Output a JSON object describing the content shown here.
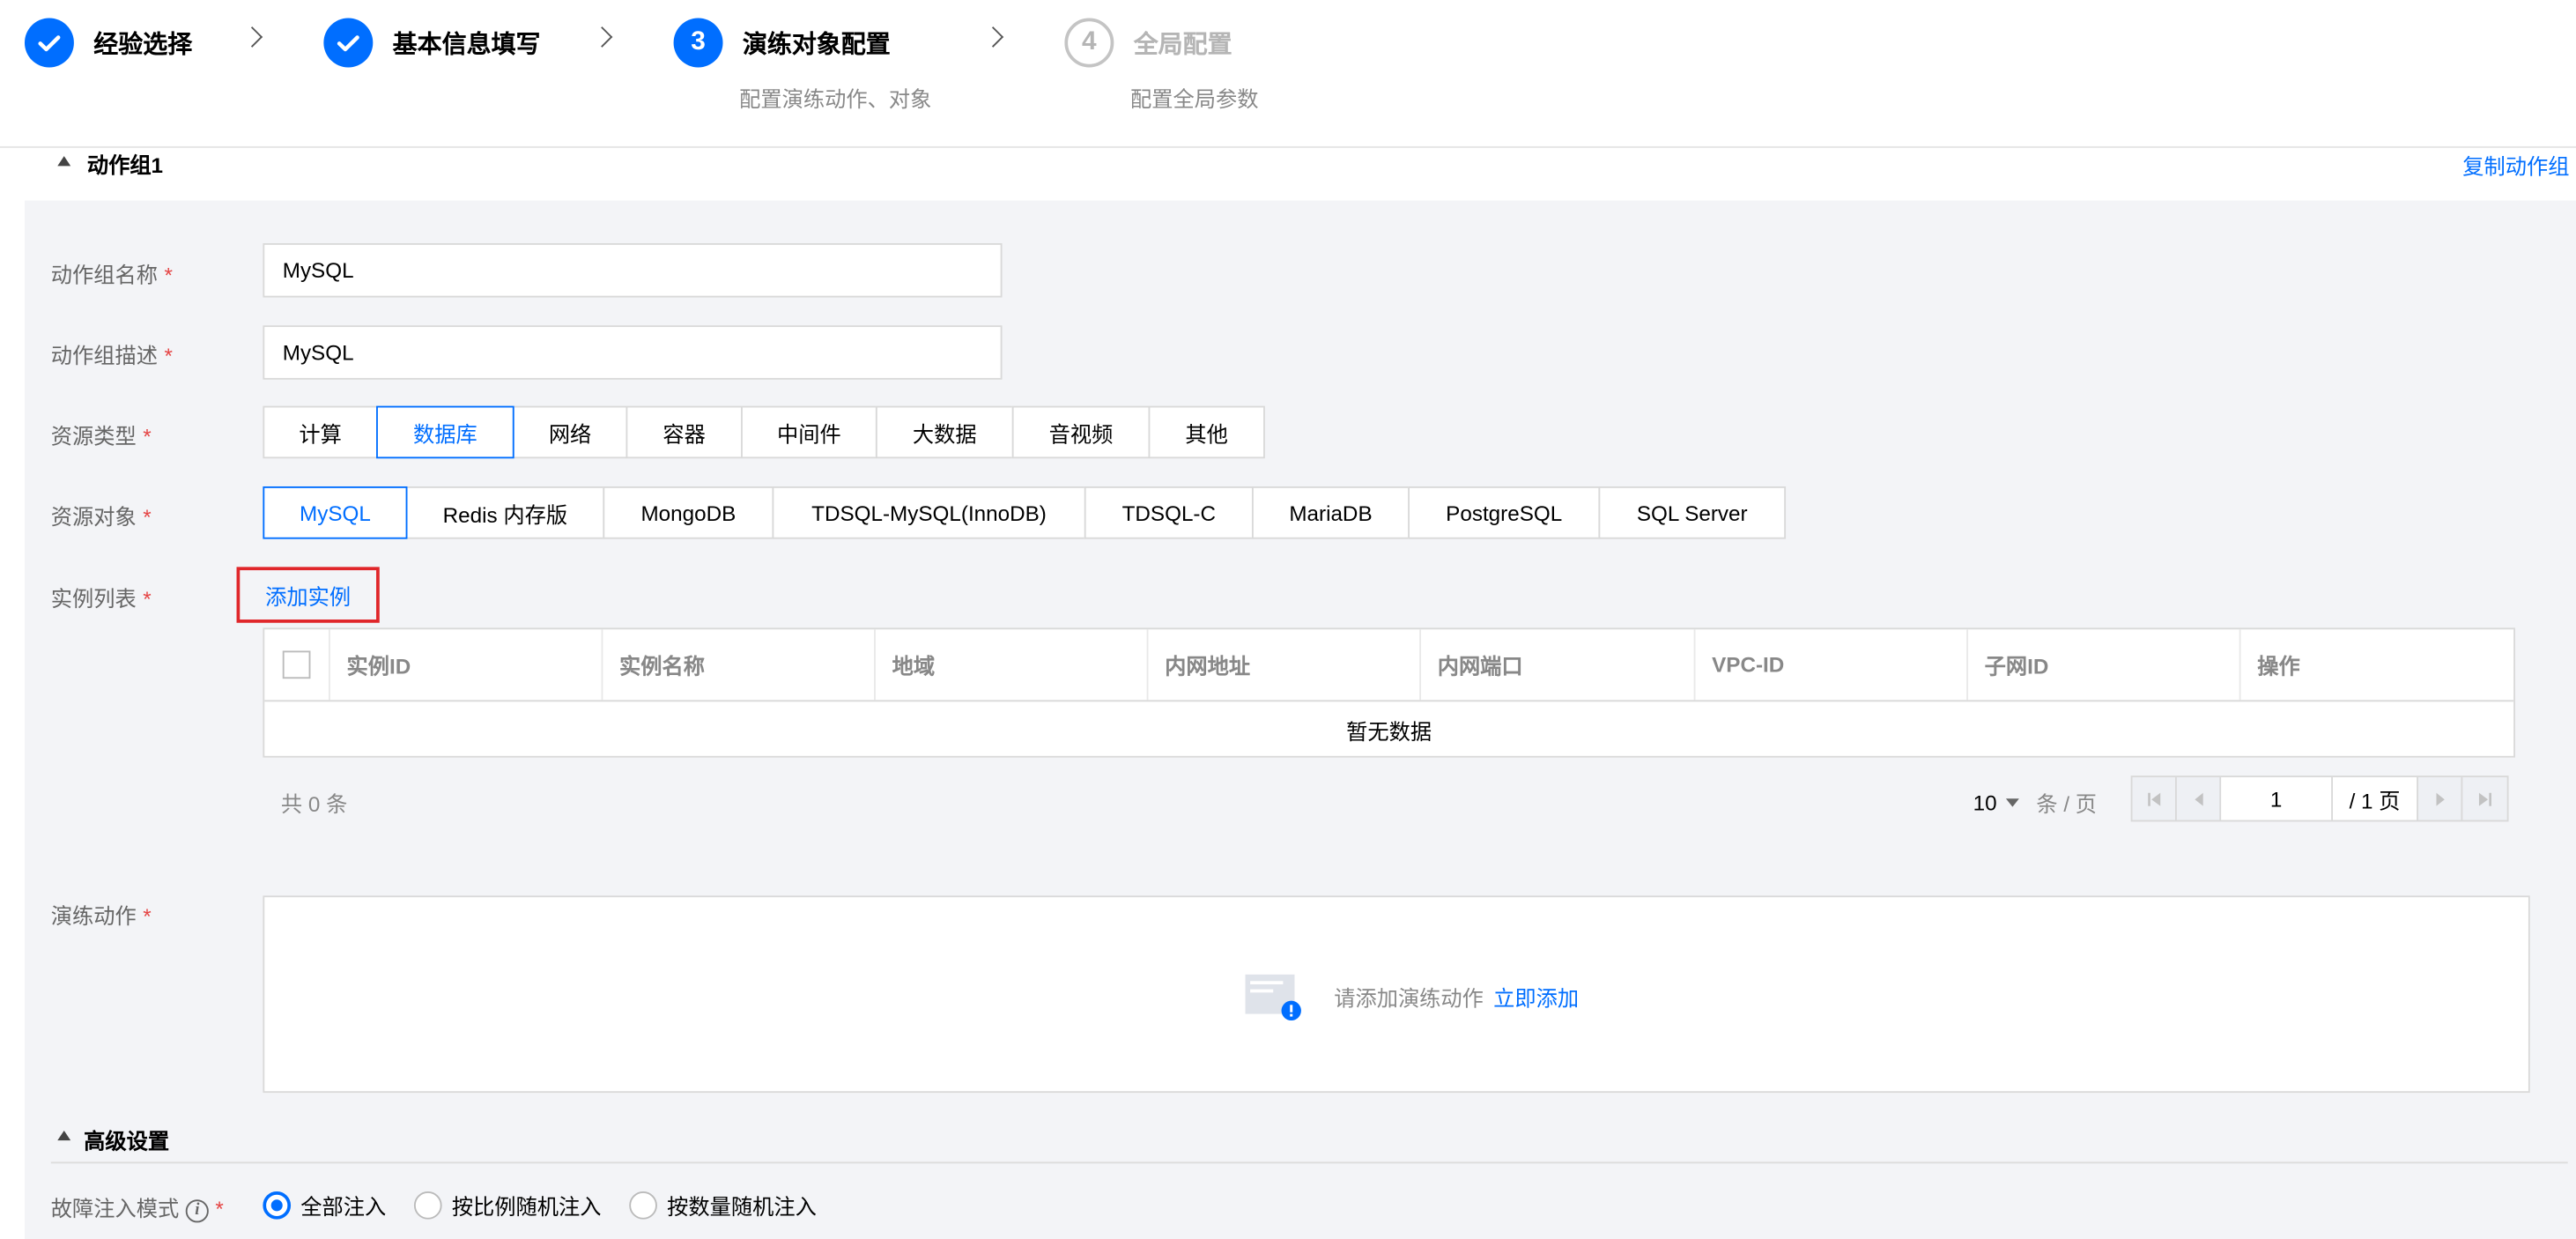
{
  "stepper": {
    "steps": [
      {
        "label": "经验选择",
        "state": "done"
      },
      {
        "label": "基本信息填写",
        "state": "done"
      },
      {
        "number": "3",
        "label": "演练对象配置",
        "sub": "配置演练动作、对象",
        "state": "active"
      },
      {
        "number": "4",
        "label": "全局配置",
        "sub": "配置全局参数",
        "state": "pending"
      }
    ]
  },
  "group": {
    "title": "动作组1",
    "copy_label": "复制动作组"
  },
  "form": {
    "name_label": "动作组名称",
    "name_value": "MySQL",
    "desc_label": "动作组描述",
    "desc_value": "MySQL",
    "resource_type_label": "资源类型",
    "resource_types": [
      "计算",
      "数据库",
      "网络",
      "容器",
      "中间件",
      "大数据",
      "音视频",
      "其他"
    ],
    "resource_type_selected": "数据库",
    "resource_object_label": "资源对象",
    "resource_objects": [
      "MySQL",
      "Redis 内存版",
      "MongoDB",
      "TDSQL-MySQL(InnoDB)",
      "TDSQL-C",
      "MariaDB",
      "PostgreSQL",
      "SQL Server"
    ],
    "resource_object_selected": "MySQL",
    "instance_list_label": "实例列表",
    "add_instance_label": "添加实例",
    "required_mark": "*"
  },
  "table": {
    "columns": [
      "实例ID",
      "实例名称",
      "地域",
      "内网地址",
      "内网端口",
      "VPC-ID",
      "子网ID",
      "操作"
    ],
    "empty_text": "暂无数据"
  },
  "pagination": {
    "total_text": "共 0 条",
    "page_size": "10",
    "per_page_text": "条 / 页",
    "current_page": "1",
    "total_pages_text": "/ 1 页"
  },
  "actions": {
    "label": "演练动作",
    "empty_text": "请添加演练动作",
    "add_now_label": "立即添加"
  },
  "advanced": {
    "title": "高级设置",
    "injection_mode_label": "故障注入模式",
    "injection_modes": [
      "全部注入",
      "按比例随机注入",
      "按数量随机注入"
    ],
    "injection_mode_selected": "全部注入"
  },
  "colors": {
    "accent": "#006eff",
    "required": "#e54545",
    "highlight_border": "#e0262a",
    "panel_bg": "#f3f4f7"
  }
}
